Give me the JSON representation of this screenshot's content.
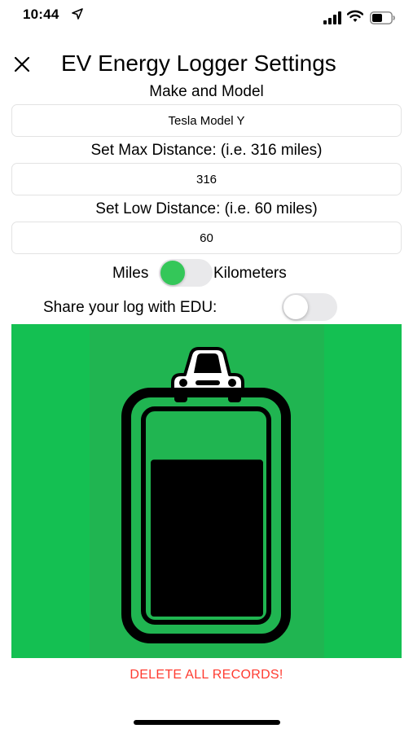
{
  "status_bar": {
    "time": "10:44"
  },
  "header": {
    "title": "EV Energy Logger Settings"
  },
  "make_model": {
    "label": "Make and Model",
    "value": "Tesla Model Y"
  },
  "max_distance": {
    "label": "Set Max Distance: (i.e. 316 miles)",
    "value": "316"
  },
  "low_distance": {
    "label": "Set Low Distance: (i.e. 60 miles)",
    "value": "60"
  },
  "units": {
    "left_label": "Miles",
    "right_label": "Kilometers",
    "toggle_state": "on"
  },
  "share": {
    "label": "Share your log with EDU:",
    "toggle_state": "off"
  },
  "battery_graphic": {
    "charge_level": 0.78,
    "colors": {
      "background": "#14c052",
      "inner_panel": "#20b551",
      "accent_toggle": "#34c759"
    },
    "icons": [
      "car-icon",
      "battery-icon"
    ]
  },
  "delete_button": {
    "label": "DELETE ALL RECORDS!",
    "color": "#ff3b30"
  }
}
